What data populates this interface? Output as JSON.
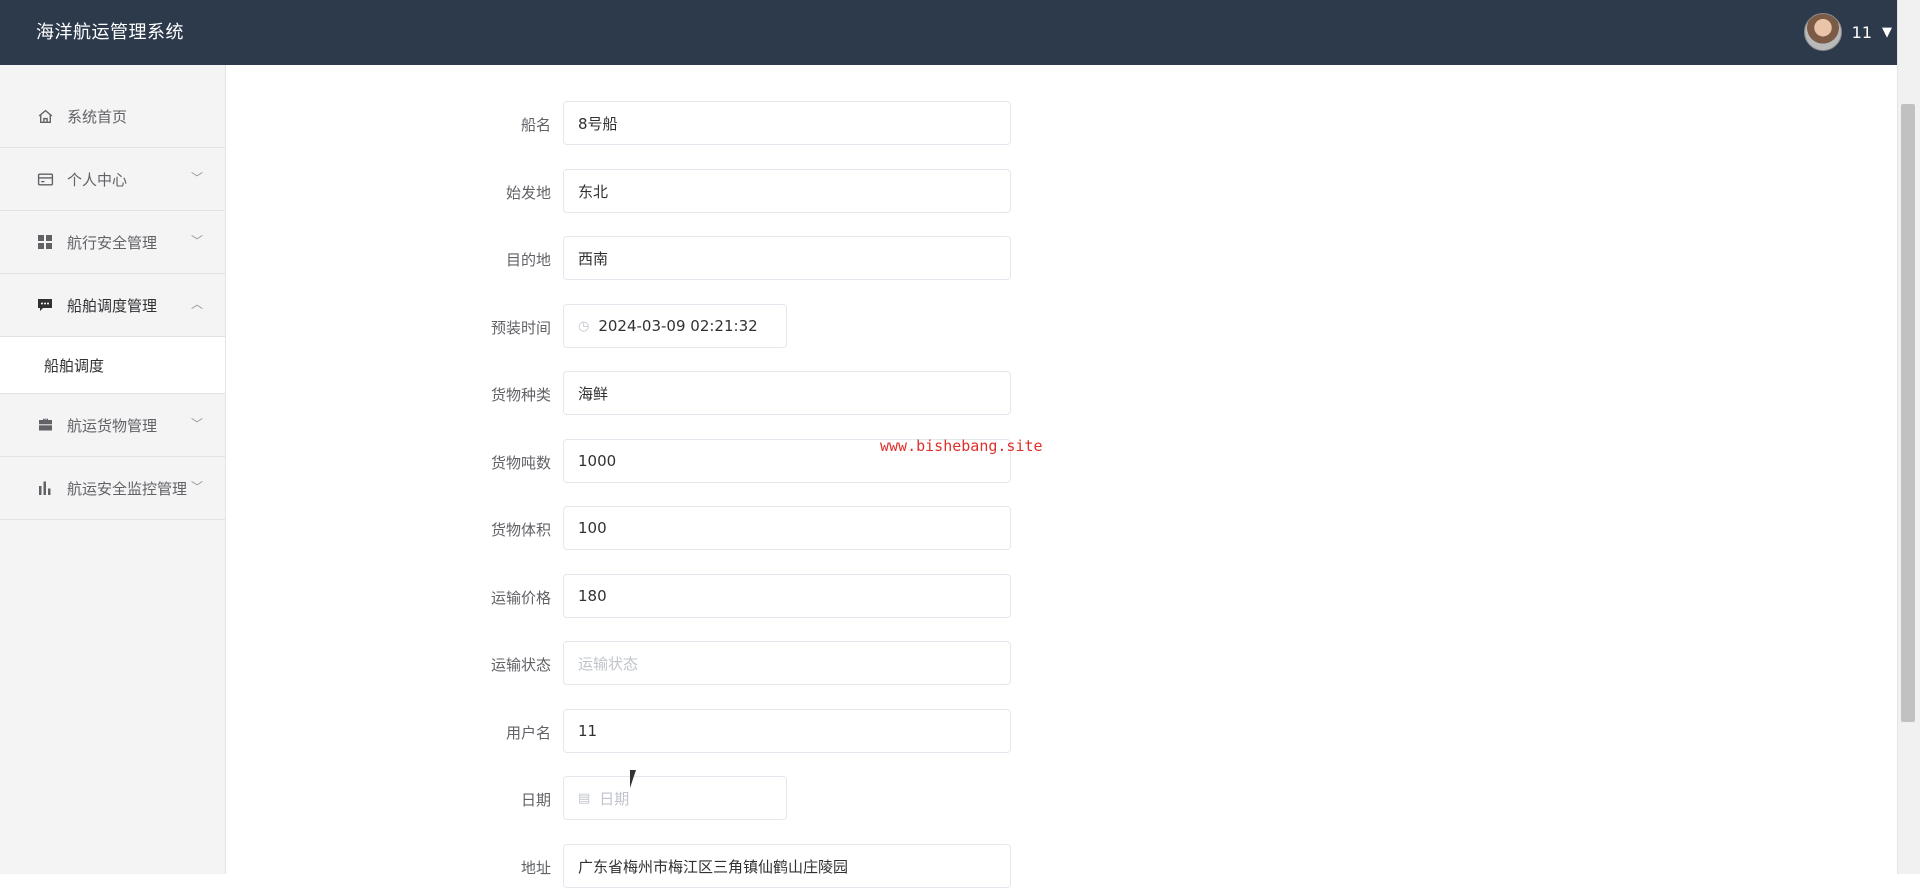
{
  "header": {
    "title": "海洋航运管理系统",
    "username": "11"
  },
  "sidebar": {
    "items": [
      {
        "label": "系统首页",
        "icon": "home-icon",
        "expandable": false
      },
      {
        "label": "个人中心",
        "icon": "wallet-icon",
        "expandable": true,
        "expanded": false
      },
      {
        "label": "航行安全管理",
        "icon": "grid-icon",
        "expandable": true,
        "expanded": false
      },
      {
        "label": "船舶调度管理",
        "icon": "chat-icon",
        "expandable": true,
        "expanded": true,
        "children": [
          {
            "label": "船舶调度"
          }
        ]
      },
      {
        "label": "航运货物管理",
        "icon": "briefcase-icon",
        "expandable": true,
        "expanded": false
      },
      {
        "label": "航运安全监控管理",
        "icon": "bar-chart-icon",
        "expandable": true,
        "expanded": false
      }
    ]
  },
  "form": {
    "fields": [
      {
        "label": "船名",
        "value": "8号船"
      },
      {
        "label": "始发地",
        "value": "东北"
      },
      {
        "label": "目的地",
        "value": "西南"
      },
      {
        "label": "预装时间",
        "value": "2024-03-09 02:21:32"
      },
      {
        "label": "货物种类",
        "value": "海鲜"
      },
      {
        "label": "货物吨数",
        "value": "1000"
      },
      {
        "label": "货物体积",
        "value": "100"
      },
      {
        "label": "运输价格",
        "value": "180"
      },
      {
        "label": "运输状态",
        "value": "",
        "placeholder": "运输状态"
      },
      {
        "label": "用户名",
        "value": "11"
      },
      {
        "label": "日期",
        "value": "",
        "placeholder": "日期"
      },
      {
        "label": "地址",
        "value": "广东省梅州市梅江区三角镇仙鹤山庄陵园"
      }
    ]
  },
  "watermark": "www.bishebang.site"
}
